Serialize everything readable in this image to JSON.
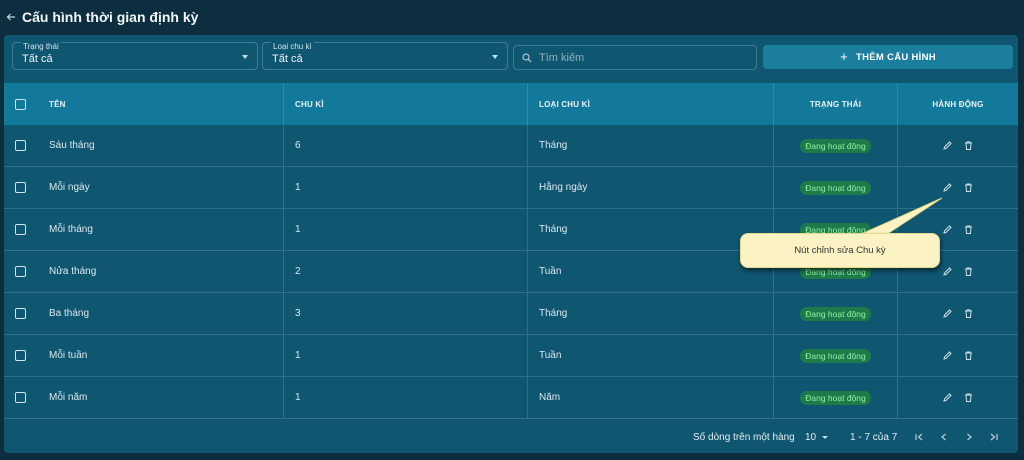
{
  "header": {
    "title": "Cấu hình thời gian định kỳ"
  },
  "filters": {
    "status": {
      "label": "Trạng thái",
      "value": "Tất cả"
    },
    "cycle_type": {
      "label": "Loại chu kì",
      "value": "Tất cả"
    },
    "search": {
      "placeholder": "Tìm kiếm"
    },
    "add_button_label": "THÊM CẤU HÌNH"
  },
  "table": {
    "columns": [
      "TÊN",
      "CHU KÌ",
      "LOẠI CHU KÌ",
      "TRẠNG THÁI",
      "HÀNH ĐỘNG"
    ],
    "rows": [
      {
        "name": "Sáu tháng",
        "cycle": "6",
        "type": "Tháng",
        "status": "Đang hoạt động"
      },
      {
        "name": "Mỗi ngày",
        "cycle": "1",
        "type": "Hằng ngày",
        "status": "Đang hoạt động"
      },
      {
        "name": "Mỗi tháng",
        "cycle": "1",
        "type": "Tháng",
        "status": "Đang hoạt động"
      },
      {
        "name": "Nửa tháng",
        "cycle": "2",
        "type": "Tuần",
        "status": "Đang hoạt động"
      },
      {
        "name": "Ba tháng",
        "cycle": "3",
        "type": "Tháng",
        "status": "Đang hoạt động"
      },
      {
        "name": "Mỗi tuần",
        "cycle": "1",
        "type": "Tuần",
        "status": "Đang hoạt động"
      },
      {
        "name": "Mỗi năm",
        "cycle": "1",
        "type": "Năm",
        "status": "Đang hoạt động"
      }
    ]
  },
  "footer": {
    "rows_per_page_label": "Số dòng trên một hàng",
    "rows_per_page_value": "10",
    "range": "1 - 7 của 7"
  },
  "callout": {
    "text": "Nút chỉnh sửa Chu kỳ"
  },
  "icons": [
    "back-arrow-icon",
    "search-icon",
    "plus-icon",
    "edit-icon",
    "trash-icon",
    "first-page-icon",
    "prev-page-icon",
    "next-page-icon",
    "last-page-icon"
  ]
}
